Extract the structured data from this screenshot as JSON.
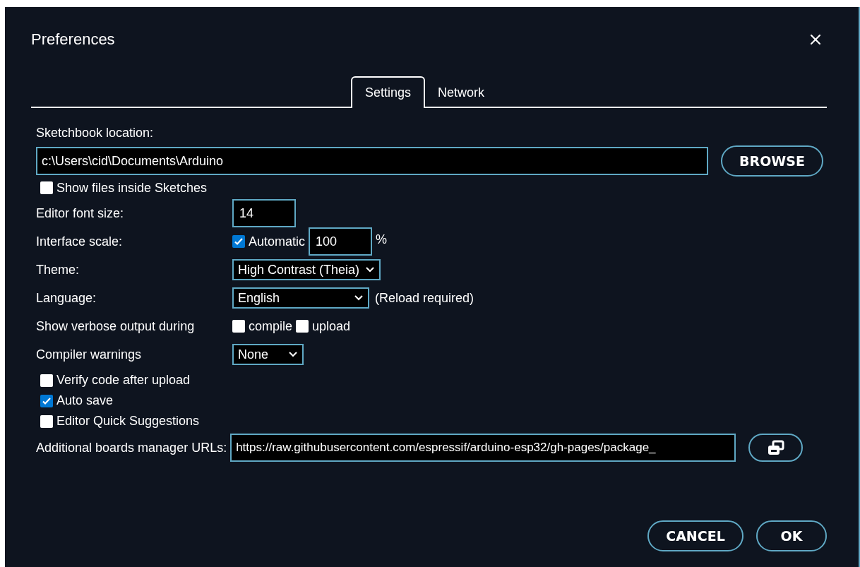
{
  "window": {
    "title": "Preferences"
  },
  "tabs": [
    {
      "label": "Settings",
      "selected": true
    },
    {
      "label": "Network",
      "selected": false
    }
  ],
  "sketchbook": {
    "label": "Sketchbook location:",
    "value": "c:\\Users\\cid\\Documents\\Arduino",
    "button": "BROWSE"
  },
  "show_files": {
    "label": "Show files inside Sketches",
    "checked": false
  },
  "rows": [
    {
      "kind": "input",
      "label": "Editor font size:",
      "value": "14"
    },
    {
      "kind": "scale",
      "label": "Interface scale:",
      "check_label": "Automatic",
      "checked": true,
      "value": "100",
      "unit": "%"
    },
    {
      "kind": "select",
      "label": "Theme:",
      "value": "High Contrast (Theia)"
    },
    {
      "kind": "select",
      "label": "Language:",
      "value": "English",
      "note": "(Reload required)"
    },
    {
      "kind": "checks",
      "label": "Show verbose output during",
      "options": [
        {
          "label": "compile",
          "checked": false
        },
        {
          "label": "upload",
          "checked": false
        }
      ]
    },
    {
      "kind": "select",
      "label": "Compiler warnings",
      "value": "None"
    }
  ],
  "options": [
    {
      "label": "Verify code after upload",
      "checked": false
    },
    {
      "label": "Auto save",
      "checked": true
    },
    {
      "label": "Editor Quick Suggestions",
      "checked": false
    }
  ],
  "boards_urls": {
    "label": "Additional boards manager URLs:",
    "value": "https://raw.githubusercontent.com/espressif/arduino-esp32/gh-pages/package_"
  },
  "buttons": [
    "CANCEL",
    "OK"
  ]
}
